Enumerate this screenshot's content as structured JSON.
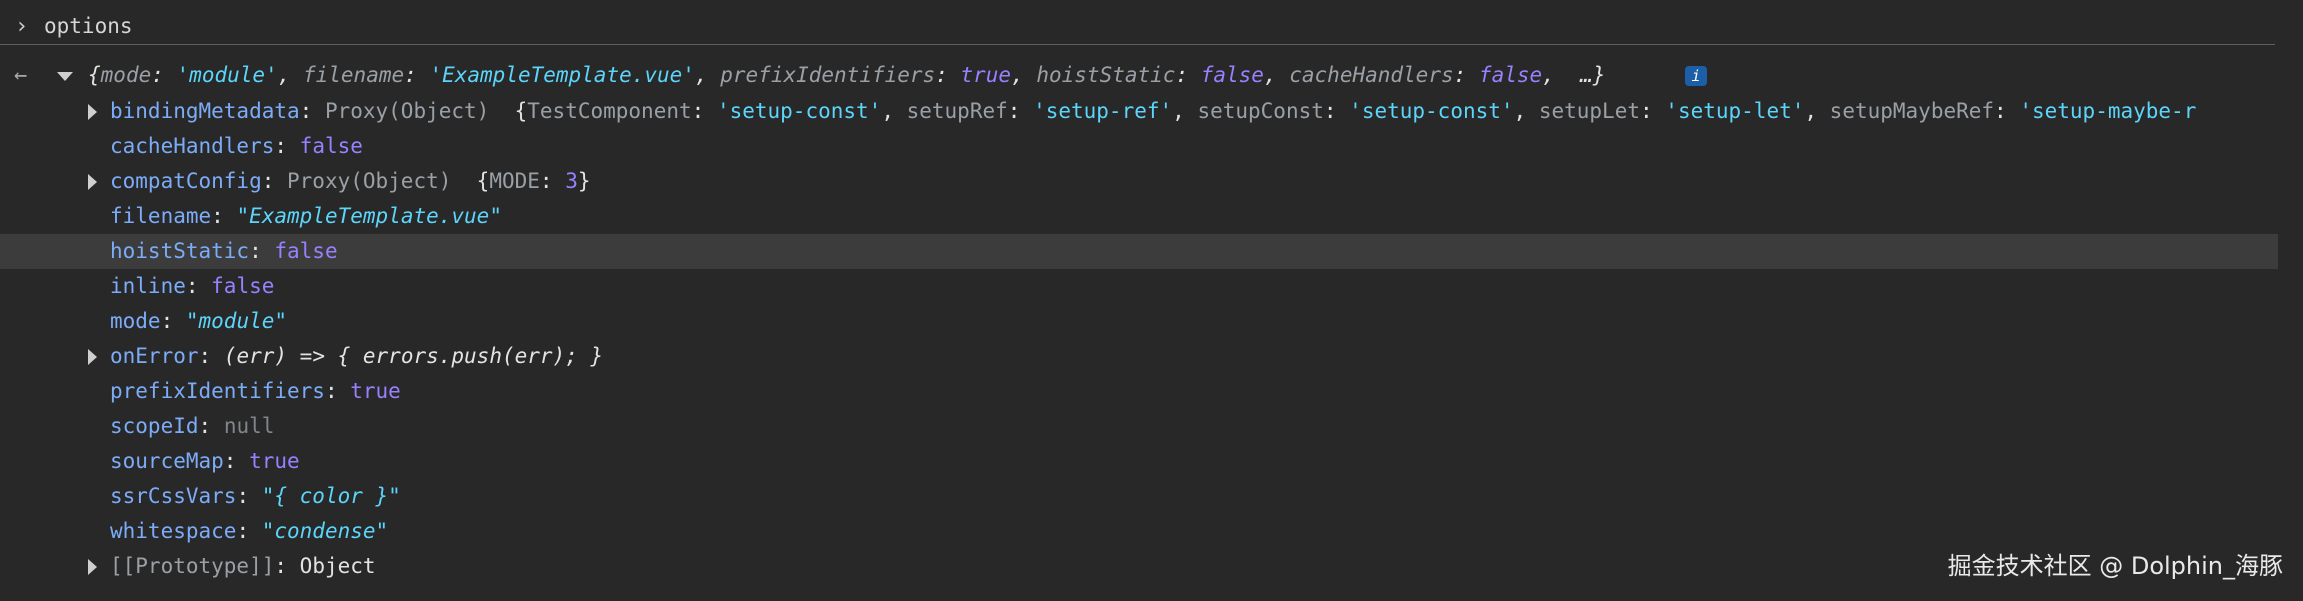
{
  "prompt": {
    "chevron": "›",
    "text": "options"
  },
  "summary": {
    "back_icon": "←",
    "open": "{",
    "entries": [
      {
        "key": "mode",
        "value": "'module'",
        "type": "str"
      },
      {
        "key": "filename",
        "value": "'ExampleTemplate.vue'",
        "type": "str"
      },
      {
        "key": "prefixIdentifiers",
        "value": "true",
        "type": "bool"
      },
      {
        "key": "hoistStatic",
        "value": "false",
        "type": "bool"
      },
      {
        "key": "cacheHandlers",
        "value": "false",
        "type": "bool"
      }
    ],
    "ellipsis": "…}",
    "info_badge": "i"
  },
  "props": [
    {
      "key": "bindingMetadata",
      "expandable": true,
      "proxy": "Proxy(Object)",
      "preview": [
        {
          "key": "TestComponent",
          "value": "'setup-const'"
        },
        {
          "key": "setupRef",
          "value": "'setup-ref'"
        },
        {
          "key": "setupConst",
          "value": "'setup-const'"
        },
        {
          "key": "setupLet",
          "value": "'setup-let'"
        },
        {
          "key": "setupMaybeRef",
          "value": "'setup-maybe-r"
        }
      ]
    },
    {
      "key": "cacheHandlers",
      "value": "false",
      "type": "bool"
    },
    {
      "key": "compatConfig",
      "expandable": true,
      "proxy": "Proxy(Object)",
      "preview": [
        {
          "key": "MODE",
          "value": "3"
        }
      ]
    },
    {
      "key": "filename",
      "value": "\"ExampleTemplate.vue\"",
      "type": "str"
    },
    {
      "key": "hoistStatic",
      "value": "false",
      "type": "bool",
      "highlighted": true
    },
    {
      "key": "inline",
      "value": "false",
      "type": "bool"
    },
    {
      "key": "mode",
      "value": "\"module\"",
      "type": "str"
    },
    {
      "key": "onError",
      "value": "(err) => { errors.push(err); }",
      "type": "fn",
      "expandable": true
    },
    {
      "key": "prefixIdentifiers",
      "value": "true",
      "type": "bool"
    },
    {
      "key": "scopeId",
      "value": "null",
      "type": "null"
    },
    {
      "key": "sourceMap",
      "value": "true",
      "type": "bool"
    },
    {
      "key": "ssrCssVars",
      "value": "\"{ color }\"",
      "type": "str"
    },
    {
      "key": "whitespace",
      "value": "\"condense\"",
      "type": "str"
    },
    {
      "key": "[[Prototype]]",
      "value": "Object",
      "type": "proto",
      "expandable": true
    }
  ],
  "watermark": "掘金技术社区 @ Dolphin_海豚"
}
